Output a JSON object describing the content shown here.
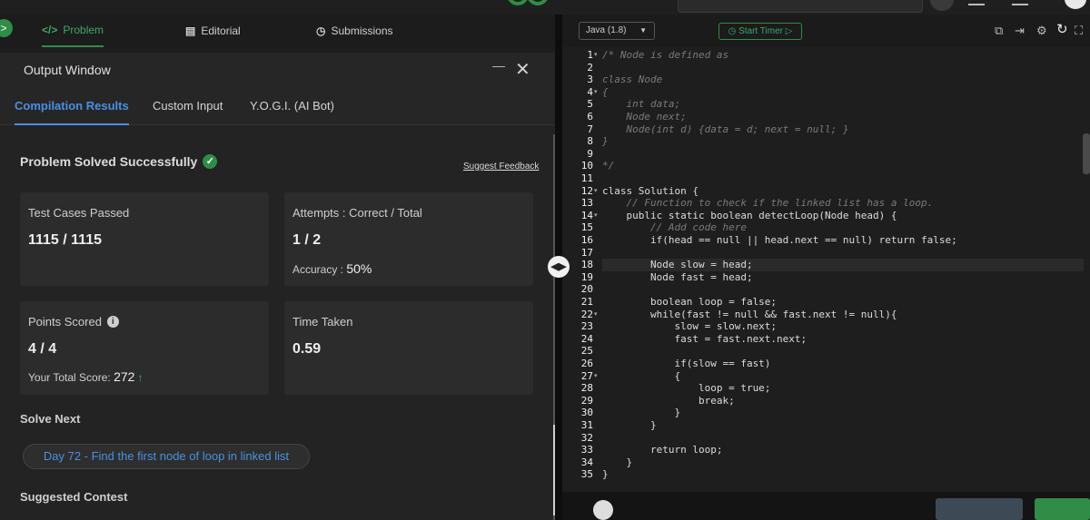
{
  "nav_tabs": [
    {
      "label": "Problem",
      "icon": "code-icon"
    },
    {
      "label": "Editorial",
      "icon": "document-icon"
    },
    {
      "label": "Submissions",
      "icon": "clock-icon"
    }
  ],
  "output_window": {
    "title": "Output Window",
    "subtabs": [
      "Compilation Results",
      "Custom Input",
      "Y.O.G.I. (AI Bot)"
    ]
  },
  "result": {
    "status": "Problem Solved Successfully",
    "feedback_link": "Suggest Feedback",
    "test_cases_label": "Test Cases Passed",
    "test_cases_value": "1115 / 1115",
    "attempts_label": "Attempts : Correct / Total",
    "attempts_value": "1 / 2",
    "accuracy_label": "Accuracy :",
    "accuracy_value": "50%",
    "points_label": "Points Scored",
    "points_value": "4 / 4",
    "total_score_label": "Your Total Score:",
    "total_score_value": "272",
    "time_label": "Time Taken",
    "time_value": "0.59"
  },
  "solve_next": {
    "heading": "Solve Next",
    "problem": "Day 72 - Find the first node of loop in linked list"
  },
  "suggested_contest": "Suggested Contest",
  "editor": {
    "language": "Java (1.8)",
    "timer_label": "Start Timer",
    "lines": [
      {
        "n": "1",
        "text": "/* Node is defined as",
        "cmt": true
      },
      {
        "n": "2",
        "text": ""
      },
      {
        "n": "3",
        "text": "class Node",
        "cmt": true
      },
      {
        "n": "4",
        "text": "{",
        "cmt": true
      },
      {
        "n": "5",
        "text": "    int data;",
        "cmt": true
      },
      {
        "n": "6",
        "text": "    Node next;",
        "cmt": true
      },
      {
        "n": "7",
        "text": "    Node(int d) {data = d; next = null; }",
        "cmt": true
      },
      {
        "n": "8",
        "text": "}",
        "cmt": true
      },
      {
        "n": "9",
        "text": ""
      },
      {
        "n": "10",
        "text": "*/",
        "cmt": true
      },
      {
        "n": "11",
        "text": ""
      },
      {
        "n": "12",
        "text": "class Solution {"
      },
      {
        "n": "13",
        "text": "    // Function to check if the linked list has a loop.",
        "cmt": true
      },
      {
        "n": "14",
        "text": "    public static boolean detectLoop(Node head) {"
      },
      {
        "n": "15",
        "text": "        // Add code here",
        "cmt": true
      },
      {
        "n": "16",
        "text": "        if(head == null || head.next == null) return false;"
      },
      {
        "n": "17",
        "text": ""
      },
      {
        "n": "18",
        "text": "        Node slow = head;",
        "hl": true
      },
      {
        "n": "19",
        "text": "        Node fast = head;"
      },
      {
        "n": "20",
        "text": ""
      },
      {
        "n": "21",
        "text": "        boolean loop = false;"
      },
      {
        "n": "22",
        "text": "        while(fast != null && fast.next != null){"
      },
      {
        "n": "23",
        "text": "            slow = slow.next;"
      },
      {
        "n": "24",
        "text": "            fast = fast.next.next;"
      },
      {
        "n": "25",
        "text": ""
      },
      {
        "n": "26",
        "text": "            if(slow == fast)"
      },
      {
        "n": "27",
        "text": "            {"
      },
      {
        "n": "28",
        "text": "                loop = true;"
      },
      {
        "n": "29",
        "text": "                break;"
      },
      {
        "n": "30",
        "text": "            }"
      },
      {
        "n": "31",
        "text": "        }"
      },
      {
        "n": "32",
        "text": ""
      },
      {
        "n": "33",
        "text": "        return loop;"
      },
      {
        "n": "34",
        "text": "    }"
      },
      {
        "n": "35",
        "text": "}"
      }
    ],
    "fold_lines": [
      "1",
      "4",
      "12",
      "14",
      "22",
      "27"
    ]
  },
  "colors": {
    "accent_green": "#2f8d46",
    "link_blue": "#4a90e2"
  }
}
